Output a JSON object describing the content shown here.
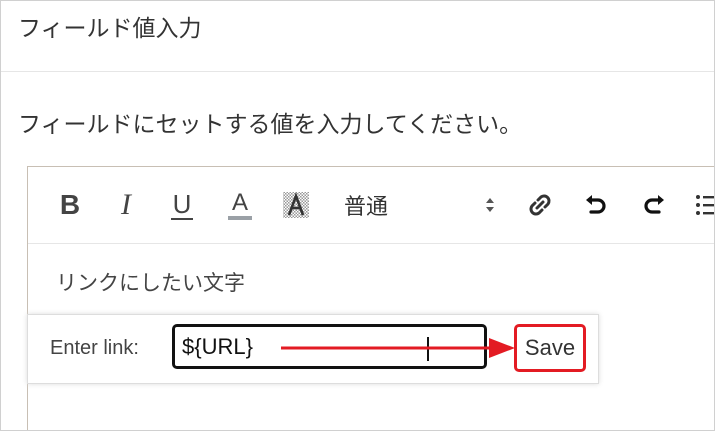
{
  "dialog": {
    "title": "フィールド値入力",
    "instruction": "フィールドにセットする値を入力してください。"
  },
  "toolbar": {
    "bold": "B",
    "italic": "I",
    "underline": "U",
    "font_color": "A",
    "background_color": "A",
    "header_select_value": "普通",
    "icons": [
      "bold-icon",
      "italic-icon",
      "underline-icon",
      "font-color-icon",
      "background-color-icon",
      "link-icon",
      "undo-icon",
      "redo-icon",
      "list-icon"
    ]
  },
  "editor": {
    "content": "リンクにしたい文字"
  },
  "link_tooltip": {
    "label": "Enter link:",
    "value": "${URL}",
    "save_label": "Save"
  },
  "annotation": {
    "highlight_color": "#e31b23"
  }
}
